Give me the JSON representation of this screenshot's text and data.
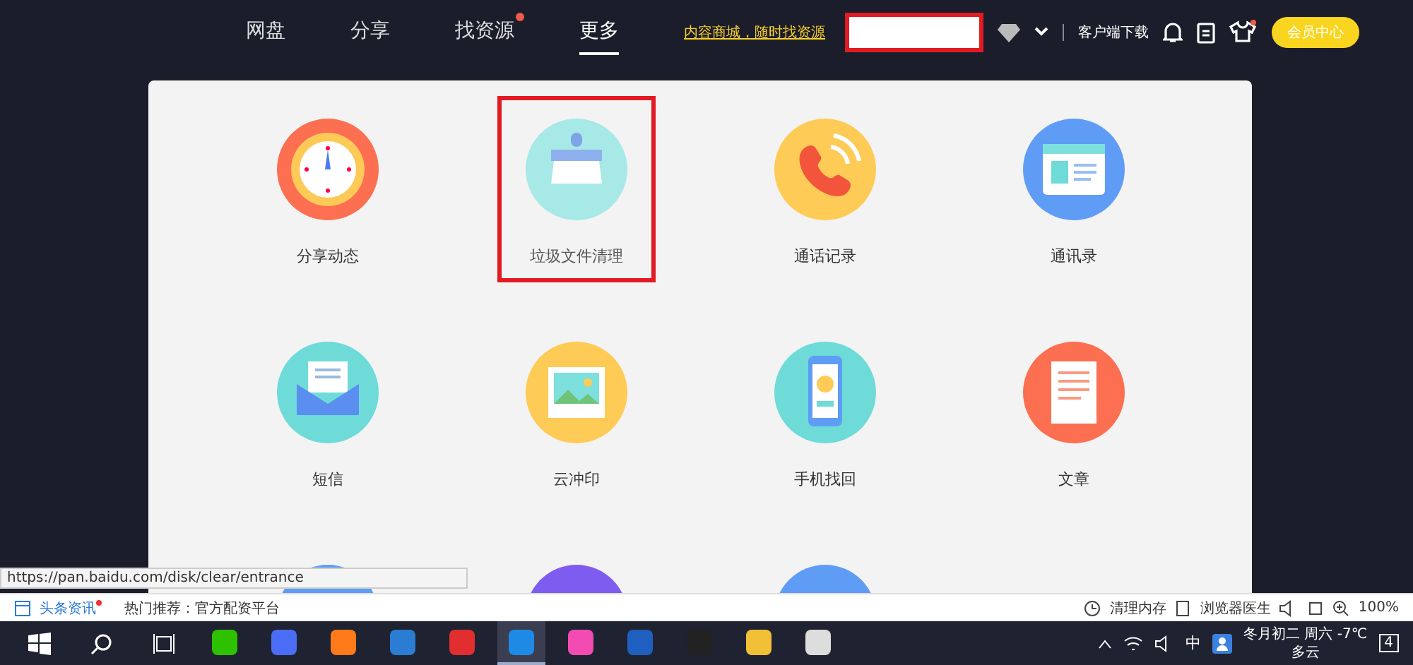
{
  "nav": {
    "tabs": [
      {
        "label": "网盘",
        "selected": false,
        "dot": false
      },
      {
        "label": "分享",
        "selected": false,
        "dot": false
      },
      {
        "label": "找资源",
        "selected": false,
        "dot": true
      },
      {
        "label": "更多",
        "selected": true,
        "dot": false
      }
    ],
    "promo_link": "内容商城，随时找资源",
    "download": "客户端下载",
    "vip_button": "会员中心"
  },
  "grid": {
    "items": [
      {
        "label": "分享动态",
        "kind": "clock",
        "color": "#fc6f50",
        "highlighted": false
      },
      {
        "label": "垃圾文件清理",
        "kind": "brush",
        "color": "#a6e9e6",
        "highlighted": true
      },
      {
        "label": "通话记录",
        "kind": "phone",
        "color": "#fecb57",
        "highlighted": false
      },
      {
        "label": "通讯录",
        "kind": "card",
        "color": "#5f9cf6",
        "highlighted": false
      },
      {
        "label": "短信",
        "kind": "mail",
        "color": "#6edbd8",
        "highlighted": false
      },
      {
        "label": "云冲印",
        "kind": "photo",
        "color": "#fecb57",
        "highlighted": false
      },
      {
        "label": "手机找回",
        "kind": "mobile",
        "color": "#6edbd8",
        "highlighted": false
      },
      {
        "label": "文章",
        "kind": "doc",
        "color": "#fc6f50",
        "highlighted": false
      },
      {
        "kind": "plain",
        "color": "#5f9cf6",
        "highlighted": false
      },
      {
        "kind": "plain",
        "color": "#7f5cf0",
        "highlighted": false
      },
      {
        "kind": "plain",
        "color": "#5f9cf6",
        "highlighted": false
      }
    ]
  },
  "url_tooltip": "https://pan.baidu.com/disk/clear/entrance",
  "status_bar": {
    "news": "头条资讯",
    "hot": "热门推荐：官方配资平台",
    "clean": "清理内存",
    "doctor": "浏览器医生",
    "zoom": "100%"
  },
  "taskbar": {
    "apps": [
      {
        "color": "#2dc100",
        "selected": false
      },
      {
        "color": "#4b6cf5",
        "selected": false
      },
      {
        "color": "#ff7a1a",
        "selected": false
      },
      {
        "color": "#2b7cd3",
        "selected": false
      },
      {
        "color": "#e12e2e",
        "selected": false
      },
      {
        "color": "#1e8ae6",
        "selected": true
      },
      {
        "color": "#f24bb1",
        "selected": false
      },
      {
        "color": "#1f5fbf",
        "selected": false
      },
      {
        "color": "#222222",
        "selected": false
      },
      {
        "color": "#f2c037",
        "selected": false
      },
      {
        "color": "#dddddd",
        "selected": false
      }
    ],
    "ime": "中",
    "date": "冬月初二 周六 -7℃",
    "weather": "多云",
    "notifications": "4"
  }
}
